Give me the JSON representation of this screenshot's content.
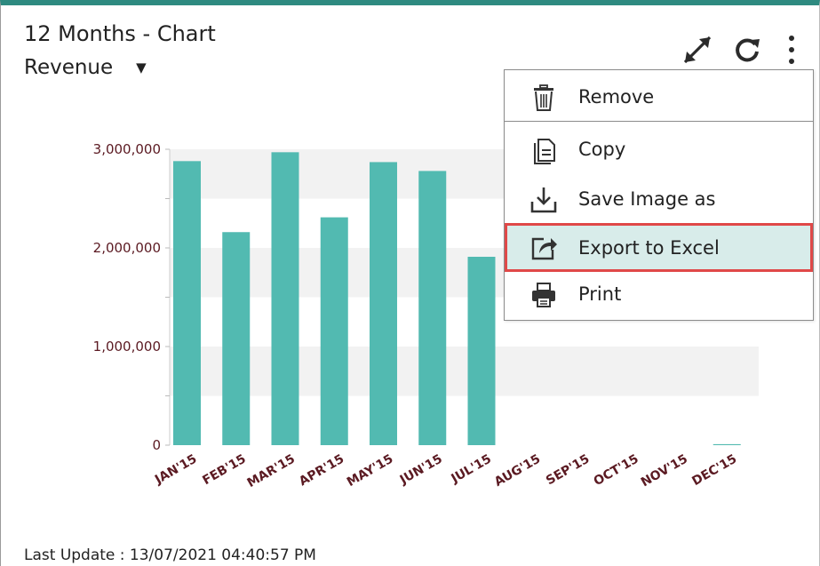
{
  "widget": {
    "title": "12 Months - Chart",
    "metric_selector": {
      "value": "Revenue"
    },
    "toolbar": {
      "expand_icon": "expand-diagonal-icon",
      "refresh_icon": "refresh-icon",
      "menu_icon": "kebab-menu-icon"
    },
    "menu": {
      "items": [
        {
          "label": "Remove",
          "icon": "trash-icon"
        },
        {
          "label": "Copy",
          "icon": "copy-document-icon"
        },
        {
          "label": "Save Image as",
          "icon": "download-icon"
        },
        {
          "label": "Export to Excel",
          "icon": "export-share-icon",
          "highlighted": true
        },
        {
          "label": "Print",
          "icon": "printer-icon"
        }
      ]
    },
    "footer": {
      "last_update": "Last Update : 13/07/2021 04:40:57 PM"
    }
  },
  "colors": {
    "accent": "#2e8a80",
    "bar": "#52bab1",
    "highlight_bg": "#d8ecea",
    "highlight_border": "#e04848",
    "tick_text": "#5b1a22"
  },
  "chart_data": {
    "type": "bar",
    "categories": [
      "JAN'15",
      "FEB'15",
      "MAR'15",
      "APR'15",
      "MAY'15",
      "JUN'15",
      "JUL'15",
      "AUG'15",
      "SEP'15",
      "OCT'15",
      "NOV'15",
      "DEC'15"
    ],
    "values": [
      2880000,
      2160000,
      2970000,
      2310000,
      2870000,
      2780000,
      1910000,
      0,
      0,
      0,
      0,
      10000
    ],
    "y_ticks": [
      {
        "value": 3000000,
        "label": "3,000,000"
      },
      {
        "value": 2000000,
        "label": "2,000,000"
      },
      {
        "value": 1000000,
        "label": "1,000,000"
      },
      {
        "value": 0,
        "label": "0"
      }
    ],
    "ylim": [
      0,
      3000000
    ],
    "grid": "alternating-bands",
    "title": "",
    "xlabel": "",
    "ylabel": ""
  }
}
